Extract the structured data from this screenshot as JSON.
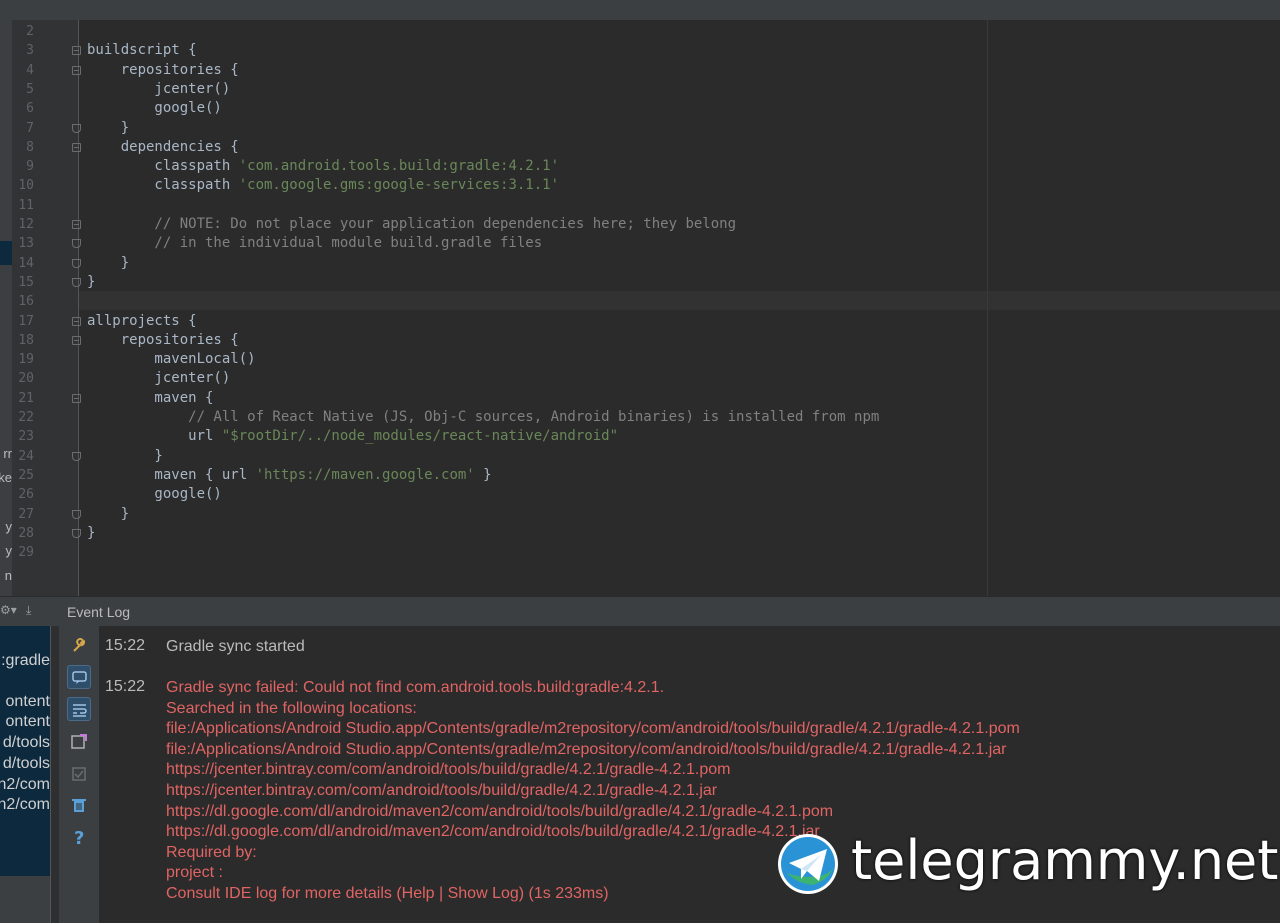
{
  "editor": {
    "line_numbers": [
      "2",
      "3",
      "4",
      "5",
      "6",
      "7",
      "8",
      "9",
      "10",
      "11",
      "12",
      "13",
      "14",
      "15",
      "16",
      "17",
      "18",
      "19",
      "20",
      "21",
      "22",
      "23",
      "24",
      "25",
      "26",
      "27",
      "28",
      "29"
    ],
    "lines": [
      {
        "n": "2",
        "parts": []
      },
      {
        "n": "3",
        "parts": [
          {
            "t": "buildscript {",
            "c": ""
          }
        ]
      },
      {
        "n": "4",
        "parts": [
          {
            "t": "    repositories {",
            "c": ""
          }
        ]
      },
      {
        "n": "5",
        "parts": [
          {
            "t": "        jcenter()",
            "c": ""
          }
        ]
      },
      {
        "n": "6",
        "parts": [
          {
            "t": "        google()",
            "c": ""
          }
        ]
      },
      {
        "n": "7",
        "parts": [
          {
            "t": "    }",
            "c": ""
          }
        ]
      },
      {
        "n": "8",
        "parts": [
          {
            "t": "    dependencies {",
            "c": ""
          }
        ]
      },
      {
        "n": "9",
        "parts": [
          {
            "t": "        classpath ",
            "c": ""
          },
          {
            "t": "'com.android.tools.build:gradle:4.2.1'",
            "c": "str"
          }
        ]
      },
      {
        "n": "10",
        "parts": [
          {
            "t": "        classpath ",
            "c": ""
          },
          {
            "t": "'com.google.gms:google-services:3.1.1'",
            "c": "str"
          }
        ]
      },
      {
        "n": "11",
        "parts": []
      },
      {
        "n": "12",
        "parts": [
          {
            "t": "        // NOTE: Do not place your application dependencies here; they belong",
            "c": "cmt"
          }
        ]
      },
      {
        "n": "13",
        "parts": [
          {
            "t": "        // in the individual module build.gradle files",
            "c": "cmt"
          }
        ]
      },
      {
        "n": "14",
        "parts": [
          {
            "t": "    }",
            "c": ""
          }
        ]
      },
      {
        "n": "15",
        "parts": [
          {
            "t": "}",
            "c": ""
          }
        ]
      },
      {
        "n": "16",
        "parts": []
      },
      {
        "n": "17",
        "parts": [
          {
            "t": "allprojects {",
            "c": ""
          }
        ]
      },
      {
        "n": "18",
        "parts": [
          {
            "t": "    repositories {",
            "c": ""
          }
        ]
      },
      {
        "n": "19",
        "parts": [
          {
            "t": "        mavenLocal()",
            "c": ""
          }
        ]
      },
      {
        "n": "20",
        "parts": [
          {
            "t": "        jcenter()",
            "c": ""
          }
        ]
      },
      {
        "n": "21",
        "parts": [
          {
            "t": "        maven {",
            "c": ""
          }
        ]
      },
      {
        "n": "22",
        "parts": [
          {
            "t": "            // All of React Native (JS, Obj-C sources, Android binaries) is installed from npm",
            "c": "cmt"
          }
        ]
      },
      {
        "n": "23",
        "parts": [
          {
            "t": "            url ",
            "c": ""
          },
          {
            "t": "\"$rootDir/../node_modules/react-native/android\"",
            "c": "str"
          }
        ]
      },
      {
        "n": "24",
        "parts": [
          {
            "t": "        }",
            "c": ""
          }
        ]
      },
      {
        "n": "25",
        "parts": [
          {
            "t": "        maven { url ",
            "c": ""
          },
          {
            "t": "'https://maven.google.com'",
            "c": "str"
          },
          {
            "t": " }",
            "c": ""
          }
        ]
      },
      {
        "n": "26",
        "parts": [
          {
            "t": "        google()",
            "c": ""
          }
        ]
      },
      {
        "n": "27",
        "parts": [
          {
            "t": "    }",
            "c": ""
          }
        ]
      },
      {
        "n": "28",
        "parts": [
          {
            "t": "}",
            "c": ""
          }
        ]
      },
      {
        "n": "29",
        "parts": []
      }
    ]
  },
  "left_fragments": {
    "editor_side": [
      "rr",
      "ke",
      "y",
      "y",
      "n"
    ],
    "panel_side": [
      ":gradle",
      "ontent",
      "ontent",
      "d/tools",
      "d/tools",
      "n2/com",
      "n2/com"
    ]
  },
  "event_log": {
    "title": "Event Log",
    "entries": [
      {
        "time": "15:22",
        "kind": "ok",
        "lines": [
          "Gradle sync started"
        ]
      },
      {
        "time": "15:22",
        "kind": "err",
        "lines": [
          "Gradle sync failed: Could not find com.android.tools.build:gradle:4.2.1.",
          "Searched in the following locations:",
          "file:/Applications/Android Studio.app/Contents/gradle/m2repository/com/android/tools/build/gradle/4.2.1/gradle-4.2.1.pom",
          "file:/Applications/Android Studio.app/Contents/gradle/m2repository/com/android/tools/build/gradle/4.2.1/gradle-4.2.1.jar",
          "https://jcenter.bintray.com/com/android/tools/build/gradle/4.2.1/gradle-4.2.1.pom",
          "https://jcenter.bintray.com/com/android/tools/build/gradle/4.2.1/gradle-4.2.1.jar",
          "https://dl.google.com/dl/android/maven2/com/android/tools/build/gradle/4.2.1/gradle-4.2.1.pom",
          "https://dl.google.com/dl/android/maven2/com/android/tools/build/gradle/4.2.1/gradle-4.2.1.jar",
          "Required by:",
          "project :",
          "Consult IDE log for more details (Help | Show Log) (1s 233ms)"
        ]
      }
    ],
    "toolbar_icons": [
      "settings-wrench-icon",
      "balloon-notification-icon",
      "toggle-soft-wraps-icon",
      "mark-all-read-icon",
      "checkbox-icon",
      "trash-icon",
      "help-question-icon"
    ]
  },
  "watermark": {
    "text": "telegrammy.net",
    "icon": "telegram-globe-icon"
  },
  "colors": {
    "error": "#e06463",
    "string": "#6a8759",
    "comment": "#808080",
    "text": "#a9b7c6"
  }
}
